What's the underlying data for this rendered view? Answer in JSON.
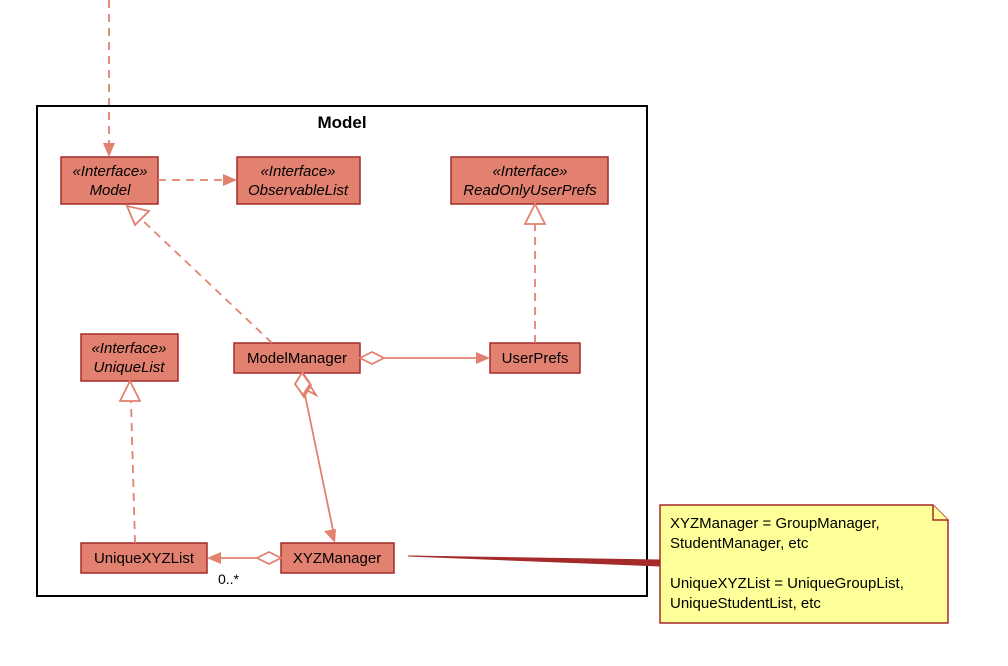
{
  "package": {
    "title": "Model"
  },
  "classes": {
    "model": {
      "stereotype": "«Interface»",
      "name": "Model"
    },
    "observableList": {
      "stereotype": "«Interface»",
      "name": "ObservableList"
    },
    "readOnlyUserPrefs": {
      "stereotype": "«Interface»",
      "name": "ReadOnlyUserPrefs"
    },
    "uniqueList": {
      "stereotype": "«Interface»",
      "name": "UniqueList"
    },
    "modelManager": {
      "name": "ModelManager"
    },
    "userPrefs": {
      "name": "UserPrefs"
    },
    "uniqueXYZList": {
      "name": "UniqueXYZList"
    },
    "xyzManager": {
      "name": "XYZManager"
    }
  },
  "multiplicities": {
    "uniqueXYZList": "0..*"
  },
  "note": {
    "line1": "XYZManager = GroupManager,",
    "line2": "StudentManager, etc",
    "line3": "UniqueXYZList = UniqueGroupList,",
    "line4": "UniqueStudentList, etc"
  },
  "relationships": [
    {
      "from": "external",
      "to": "Model",
      "type": "dependency"
    },
    {
      "from": "Model",
      "to": "ObservableList",
      "type": "dependency"
    },
    {
      "from": "ModelManager",
      "to": "Model",
      "type": "realization"
    },
    {
      "from": "ModelManager",
      "to": "UserPrefs",
      "type": "aggregation"
    },
    {
      "from": "ModelManager",
      "to": "XYZManager",
      "type": "aggregation"
    },
    {
      "from": "UserPrefs",
      "to": "ReadOnlyUserPrefs",
      "type": "realization"
    },
    {
      "from": "UniqueXYZList",
      "to": "UniqueList",
      "type": "realization"
    },
    {
      "from": "XYZManager",
      "to": "UniqueXYZList",
      "type": "aggregation",
      "multiplicity": "0..*"
    },
    {
      "from": "note",
      "to": "XYZManager",
      "type": "note-link"
    }
  ]
}
